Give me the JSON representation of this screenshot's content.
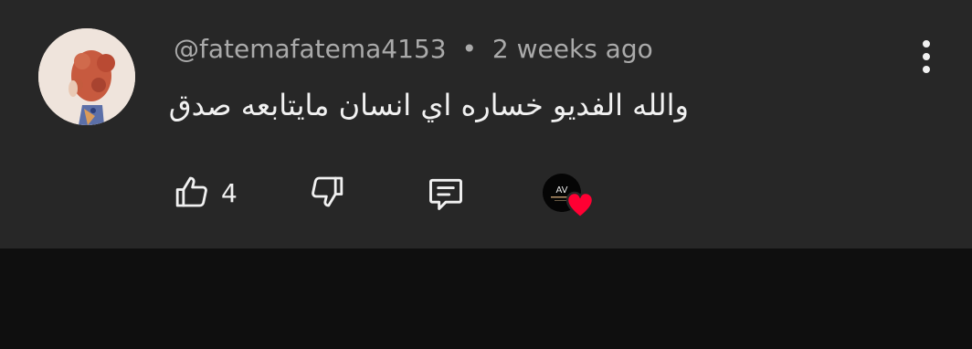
{
  "comment": {
    "author_handle": "@fatemafatema4153",
    "separator": "•",
    "timestamp": "2 weeks ago",
    "text": "والله الفديو خساره اي انسان مايتابعه صدق"
  },
  "actions": {
    "like_count": "4",
    "like_icon": "thumbs-up-icon",
    "dislike_icon": "thumbs-down-icon",
    "reply_icon": "reply-comment-icon",
    "menu_icon": "more-vertical-icon"
  },
  "creator_heart": {
    "avatar_text": "AV",
    "heart_color": "#ff0033"
  },
  "colors": {
    "card_background": "#272727",
    "page_background": "#0f0f0f",
    "primary_text": "#f1f1f1",
    "secondary_text": "#aaaaaa"
  }
}
